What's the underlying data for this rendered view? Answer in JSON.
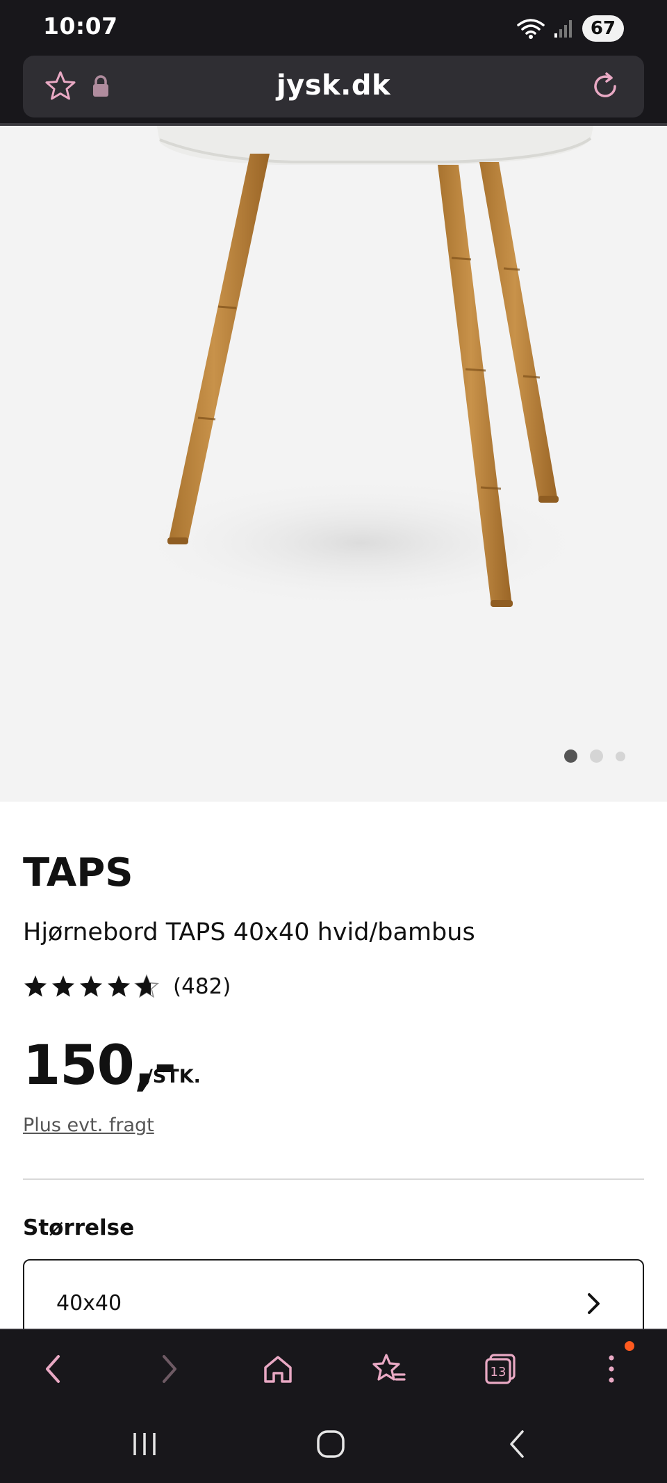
{
  "status_bar": {
    "time": "10:07",
    "battery": "67",
    "icons": [
      "wifi-icon",
      "signal-icon",
      "battery-icon"
    ]
  },
  "browser": {
    "url": "jysk.dk",
    "icons": [
      "star-icon",
      "lock-icon",
      "reload-icon"
    ]
  },
  "gallery": {
    "total_images": 3,
    "active_index": 0
  },
  "product": {
    "brand": "TAPS",
    "name": "Hjørnebord TAPS 40x40 hvid/bambus",
    "rating": 4.5,
    "rating_max": 5,
    "review_count": "(482)",
    "price": "150,-",
    "price_unit": "/STK.",
    "freight_link": "Plus evt. fragt",
    "size_label": "Størrelse",
    "size_value": "40x40"
  },
  "toolbar": {
    "items": [
      "back-icon",
      "forward-icon",
      "home-icon",
      "bookmarks-icon",
      "tabs-icon",
      "menu-icon"
    ],
    "tabs_count": "13"
  },
  "colors": {
    "accent": "#e9a9c4",
    "notification": "#ff5a1f",
    "bar_bg": "#18171b"
  }
}
